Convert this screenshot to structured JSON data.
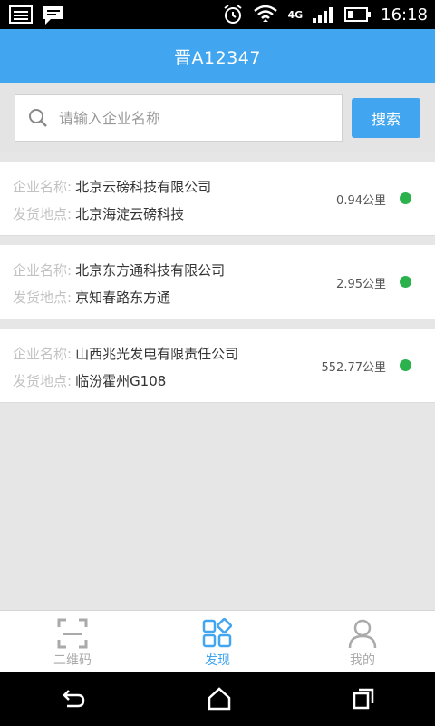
{
  "status_bar": {
    "time": "16:18",
    "network": "4G"
  },
  "header": {
    "title": "晋A12347"
  },
  "search": {
    "placeholder": "请输入企业名称",
    "button_label": "搜索"
  },
  "list": {
    "company_label": "企业名称:",
    "location_label": "发货地点:",
    "items": [
      {
        "company": "北京云磅科技有限公司",
        "location": "北京海淀云磅科技",
        "distance": "0.94公里",
        "status_color": "#2bb24c"
      },
      {
        "company": "北京东方通科技有限公司",
        "location": "京知春路东方通",
        "distance": "2.95公里",
        "status_color": "#2bb24c"
      },
      {
        "company": "山西兆光发电有限责任公司",
        "location": "临汾霍州G108",
        "distance": "552.77公里",
        "status_color": "#2bb24c"
      }
    ]
  },
  "bottom_nav": {
    "items": [
      {
        "label": "二维码",
        "icon": "qr-scan-icon",
        "active": false
      },
      {
        "label": "发现",
        "icon": "discover-icon",
        "active": true
      },
      {
        "label": "我的",
        "icon": "profile-icon",
        "active": false
      }
    ]
  },
  "colors": {
    "accent": "#42a5f0",
    "status_dot": "#2bb24c"
  }
}
